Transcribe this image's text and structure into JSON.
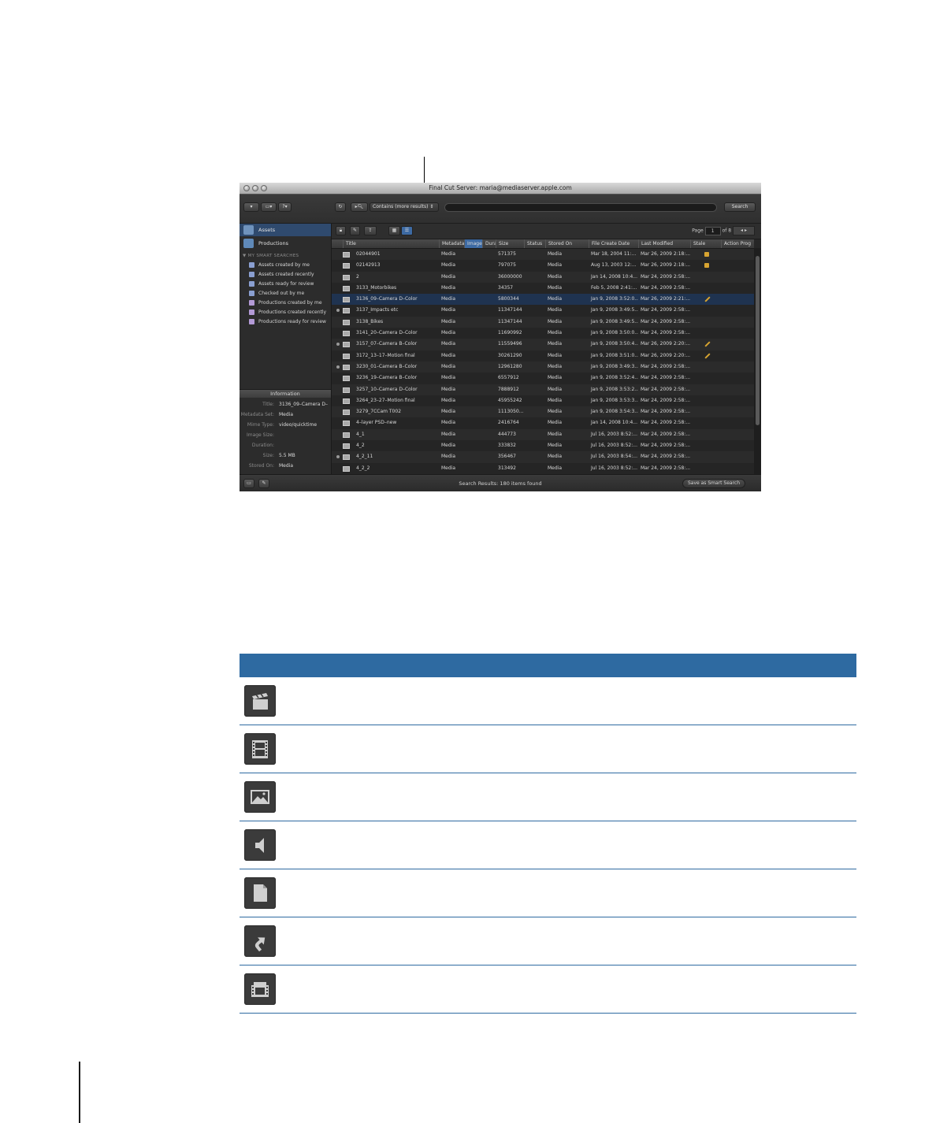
{
  "window": {
    "title": "Final Cut Server: maria@mediaserver.apple.com",
    "toolbar": {
      "search_mode": "Contains (more results)",
      "search_button": "Search"
    }
  },
  "sidebar": {
    "items": [
      {
        "label": "Assets",
        "selected": true
      },
      {
        "label": "Productions",
        "selected": false
      }
    ],
    "smart_header": "▼ MY SMART SEARCHES",
    "smart_searches": [
      "Assets created by me",
      "Assets created recently",
      "Assets ready for review",
      "Checked out by me",
      "Productions created by me",
      "Productions created recently",
      "Productions ready for review"
    ]
  },
  "info": {
    "title": "Information",
    "rows": [
      {
        "key": "Title:",
        "value": "3136_09–Camera D–"
      },
      {
        "key": "Metadata Set:",
        "value": "Media"
      },
      {
        "key": "Mime Type:",
        "value": "video/quicktime"
      },
      {
        "key": "Image Size:",
        "value": ""
      },
      {
        "key": "Duration:",
        "value": ""
      },
      {
        "key": "Size:",
        "value": "5.5 MB"
      },
      {
        "key": "Stored On:",
        "value": "Media"
      }
    ]
  },
  "pager": {
    "page_label": "Page",
    "page": "1",
    "of_label": "of 8"
  },
  "table": {
    "columns": [
      "Title",
      "Metadata",
      "Image",
      "Dura",
      "Size",
      "Status",
      "Stored On",
      "File Create Date",
      "Last Modified",
      "Stale",
      "Action Prog"
    ],
    "rows": [
      {
        "title": "02044901",
        "metadata": "Media",
        "size": "571375",
        "stored": "Media",
        "created": "Mar 18, 2004 11:...",
        "modified": "Mar 26, 2009 2:18:...",
        "stale": "lock",
        "dot": false,
        "sel": false
      },
      {
        "title": "02142913",
        "metadata": "Media",
        "size": "797075",
        "stored": "Media",
        "created": "Aug 13, 2003 12:...",
        "modified": "Mar 26, 2009 2:18:...",
        "stale": "lock",
        "dot": false,
        "sel": false
      },
      {
        "title": "2",
        "metadata": "Media",
        "size": "36000000",
        "stored": "Media",
        "created": "Jan 14, 2008 10:4...",
        "modified": "Mar 24, 2009 2:58:...",
        "stale": "",
        "dot": false,
        "sel": false
      },
      {
        "title": "3133_Motorbikes",
        "metadata": "Media",
        "size": "34357",
        "stored": "Media",
        "created": "Feb 5, 2008 2:41:...",
        "modified": "Mar 24, 2009 2:58:...",
        "stale": "",
        "dot": false,
        "sel": false
      },
      {
        "title": "3136_09–Camera D–Color",
        "metadata": "Media",
        "size": "5800344",
        "stored": "Media",
        "created": "Jan 9, 2008 3:52:0...",
        "modified": "Mar 26, 2009 2:21:...",
        "stale": "pen",
        "dot": false,
        "sel": true
      },
      {
        "title": "3137_Impacts etc",
        "metadata": "Media",
        "size": "11347144",
        "stored": "Media",
        "created": "Jan 9, 2008 3:49:5...",
        "modified": "Mar 24, 2009 2:58:...",
        "stale": "",
        "dot": true,
        "sel": false
      },
      {
        "title": "3138_Bikes",
        "metadata": "Media",
        "size": "11347144",
        "stored": "Media",
        "created": "Jan 9, 2008 3:49:5...",
        "modified": "Mar 24, 2009 2:58:...",
        "stale": "",
        "dot": false,
        "sel": false
      },
      {
        "title": "3141_20–Camera D–Color",
        "metadata": "Media",
        "size": "11690992",
        "stored": "Media",
        "created": "Jan 9, 2008 3:50:0...",
        "modified": "Mar 24, 2009 2:58:...",
        "stale": "",
        "dot": false,
        "sel": false
      },
      {
        "title": "3157_07–Camera B–Color",
        "metadata": "Media",
        "size": "11559496",
        "stored": "Media",
        "created": "Jan 9, 2008 3:50:4...",
        "modified": "Mar 26, 2009 2:20:...",
        "stale": "pen",
        "dot": true,
        "sel": false
      },
      {
        "title": "3172_13–17–Motion final",
        "metadata": "Media",
        "size": "30261290",
        "stored": "Media",
        "created": "Jan 9, 2008 3:51:0...",
        "modified": "Mar 26, 2009 2:20:...",
        "stale": "pen",
        "dot": false,
        "sel": false
      },
      {
        "title": "3230_01–Camera B–Color",
        "metadata": "Media",
        "size": "12961280",
        "stored": "Media",
        "created": "Jan 9, 2008 3:49:3...",
        "modified": "Mar 24, 2009 2:58:...",
        "stale": "",
        "dot": true,
        "sel": false
      },
      {
        "title": "3236_19–Camera B–Color",
        "metadata": "Media",
        "size": "6557912",
        "stored": "Media",
        "created": "Jan 9, 2008 3:52:4...",
        "modified": "Mar 24, 2009 2:58:...",
        "stale": "",
        "dot": false,
        "sel": false
      },
      {
        "title": "3257_10–Camera D–Color",
        "metadata": "Media",
        "size": "7888912",
        "stored": "Media",
        "created": "Jan 9, 2008 3:53:2...",
        "modified": "Mar 24, 2009 2:58:...",
        "stale": "",
        "dot": false,
        "sel": false
      },
      {
        "title": "3264_23–27–Motion final",
        "metadata": "Media",
        "size": "45955242",
        "stored": "Media",
        "created": "Jan 9, 2008 3:53:3...",
        "modified": "Mar 24, 2009 2:58:...",
        "stale": "",
        "dot": false,
        "sel": false
      },
      {
        "title": "3279_7CCam T002",
        "metadata": "Media",
        "size": "1113050...",
        "stored": "Media",
        "created": "Jan 9, 2008 3:54:3...",
        "modified": "Mar 24, 2009 2:58:...",
        "stale": "",
        "dot": false,
        "sel": false
      },
      {
        "title": "4–layer PSD–new",
        "metadata": "Media",
        "size": "2416764",
        "stored": "Media",
        "created": "Jan 14, 2008 10:4...",
        "modified": "Mar 24, 2009 2:58:...",
        "stale": "",
        "dot": false,
        "sel": false
      },
      {
        "title": "4_1",
        "metadata": "Media",
        "size": "444773",
        "stored": "Media",
        "created": "Jul 16, 2003 8:52:...",
        "modified": "Mar 24, 2009 2:58:...",
        "stale": "",
        "dot": false,
        "sel": false
      },
      {
        "title": "4_2",
        "metadata": "Media",
        "size": "333832",
        "stored": "Media",
        "created": "Jul 16, 2003 8:52:...",
        "modified": "Mar 24, 2009 2:58:...",
        "stale": "",
        "dot": false,
        "sel": false
      },
      {
        "title": "4_2_11",
        "metadata": "Media",
        "size": "356467",
        "stored": "Media",
        "created": "Jul 16, 2003 8:54:...",
        "modified": "Mar 24, 2009 2:58:...",
        "stale": "",
        "dot": true,
        "sel": false
      },
      {
        "title": "4_2_2",
        "metadata": "Media",
        "size": "313492",
        "stored": "Media",
        "created": "Jul 16, 2003 8:52:...",
        "modified": "Mar 24, 2009 2:58:...",
        "stale": "",
        "dot": false,
        "sel": false
      }
    ]
  },
  "status": {
    "text": "Search Results: 180 items found",
    "smart_button": "Save as Smart Search"
  },
  "legend": {
    "accent": "#2e6aa1",
    "icons": [
      "clapper-icon",
      "film-strip-icon",
      "image-icon",
      "audio-speaker-icon",
      "document-icon",
      "alias-arrow-icon",
      "film-bundle-icon"
    ]
  }
}
